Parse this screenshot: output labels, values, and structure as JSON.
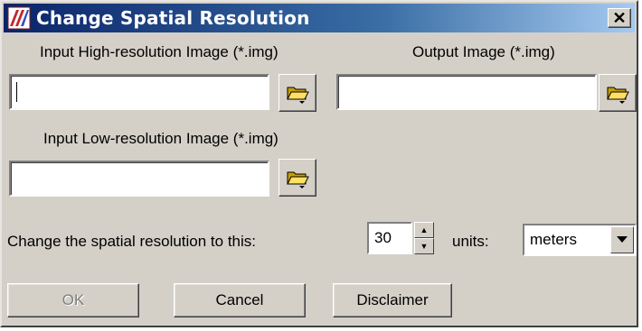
{
  "window": {
    "title": "Change Spatial Resolution",
    "close_label": "✕"
  },
  "inputs": {
    "high_res_label": "Input High-resolution Image (*.img)",
    "high_res_value": "",
    "output_label": "Output Image (*.img)",
    "output_value": "",
    "low_res_label": "Input Low-resolution Image (*.img)",
    "low_res_value": ""
  },
  "resolution": {
    "label": "Change the spatial resolution to this:",
    "value": "30",
    "units_label": "units:",
    "units_value": "meters"
  },
  "buttons": {
    "ok": "OK",
    "cancel": "Cancel",
    "disclaimer": "Disclaimer"
  },
  "icons": {
    "app": "app-icon",
    "folder": "folder-open-icon",
    "close": "close-icon"
  }
}
